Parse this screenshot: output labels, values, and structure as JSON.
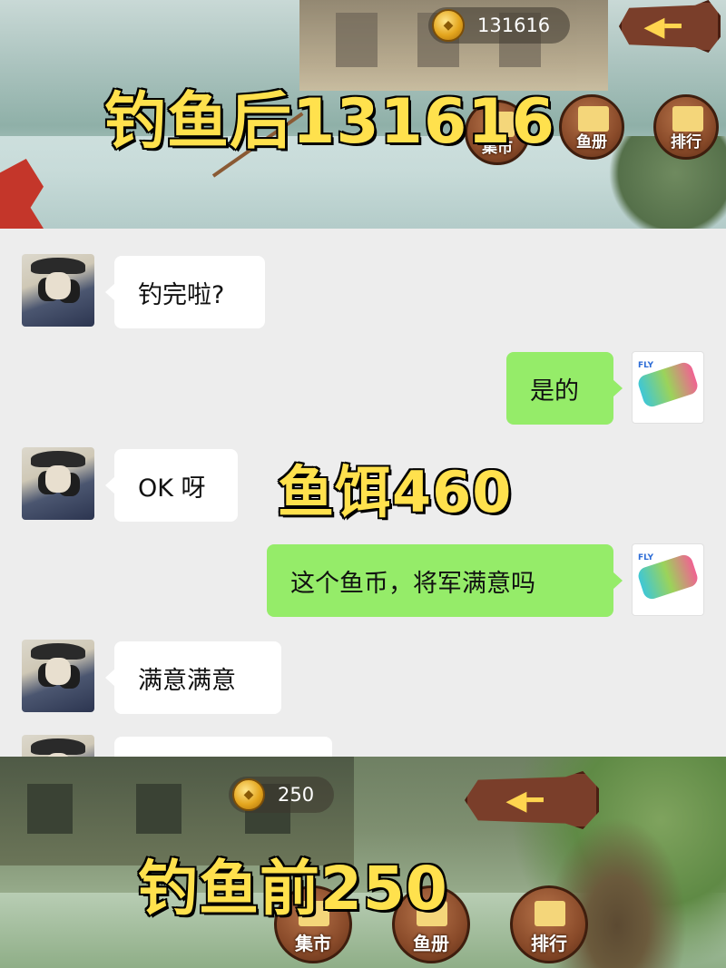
{
  "top_game": {
    "coin_count": "131616",
    "caption": "钓鱼后131616",
    "buttons": [
      {
        "label": "集市",
        "icon": "market-icon"
      },
      {
        "label": "鱼册",
        "icon": "book-icon"
      },
      {
        "label": "排行",
        "icon": "ranking-icon"
      }
    ]
  },
  "chat": {
    "messages": [
      {
        "side": "left",
        "sender": "general",
        "text": "钓完啦?"
      },
      {
        "side": "right",
        "sender": "me",
        "text": "是的"
      },
      {
        "side": "left",
        "sender": "general",
        "text": "OK 呀"
      },
      {
        "side": "right",
        "sender": "me",
        "text": "这个鱼币，将军满意吗"
      },
      {
        "side": "left",
        "sender": "general",
        "text": "满意满意"
      }
    ],
    "overlay_caption": "鱼饵460",
    "me_avatar_text": "FLY"
  },
  "bottom_game": {
    "coin_count": "250",
    "caption": "钓鱼前250",
    "buttons": [
      {
        "label": "集市",
        "icon": "market-icon"
      },
      {
        "label": "鱼册",
        "icon": "book-icon"
      },
      {
        "label": "排行",
        "icon": "ranking-icon"
      }
    ]
  },
  "colors": {
    "caption_fill": "#ffe14d",
    "bubble_sent": "#95ec69",
    "bubble_received": "#ffffff",
    "chat_bg": "#ededed"
  }
}
